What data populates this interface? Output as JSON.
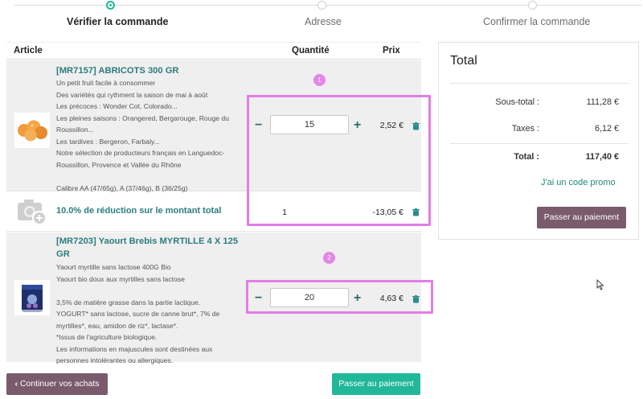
{
  "steps": [
    {
      "label": "Vérifier la commande",
      "active": true
    },
    {
      "label": "Adresse",
      "active": false
    },
    {
      "label": "Confirmer la commande",
      "active": false
    }
  ],
  "table": {
    "headers": {
      "article": "Article",
      "quantity": "Quantité",
      "price": "Prix"
    }
  },
  "items": [
    {
      "title_line1": "[MR7157] ABRICOTS 300 GR",
      "title_line2": "",
      "description": "Un petit fruit facile à consommer\nDes variétés qui rythment la saison de mai à août\nLes précoces : Wonder Cot, Colorado...\nLes pleines saisons : Orangered, Bergarouge, Rouge du\nRoussillon...\nLes tardives : Bergeron, Farbaly...\nNotre sélection de producteurs français en Languedoc-\nRoussillon, Provence et Vallée du Rhône\n\nCalibre AA (47/65g), A (37/46g), B (36/25g)",
      "quantity": "15",
      "price": "2,52 €",
      "image_icon": "apricots-photo",
      "badge": "1"
    },
    {
      "title_line1": "10.0% de réduction sur le montant total",
      "quantity": "1",
      "price": "-13,05 €",
      "image_icon": "camera-placeholder-icon"
    },
    {
      "title_line1": "[MR7203] Yaourt Brebis MYRTILLE 4 X 125",
      "title_line2": "GR",
      "description": "Yaourt myrtille sans lactose 400G Bio\nYaourt bio doux aux myrtilles sans lactose\n\n3,5% de matière grasse dans la partie lactique.\nYOGURT* sans lactose, sucre de canne brut*, 7% de\nmyrtilles*, eau, amidon de riz*, lactase*.\n*Issus de l'agriculture biologique.\nLes informations en majuscules sont destinées aux\npersonnes intolérantes ou allergiques.",
      "quantity": "20",
      "price": "4,63 €",
      "image_icon": "yogurt-photo",
      "badge": "2"
    }
  ],
  "buttons": {
    "continue": "Continuer vos achats",
    "pay_bottom": "Passer au paiement"
  },
  "summary": {
    "title": "Total",
    "subtotal_label": "Sous-total :",
    "subtotal_value": "111,28 €",
    "taxes_label": "Taxes :",
    "taxes_value": "6,12 €",
    "total_label": "Total :",
    "total_value": "117,40 €",
    "promo": "J'ai un code promo",
    "pay_button": "Passer au paiement"
  },
  "colors": {
    "accent_teal": "#21b799",
    "title_teal": "#2c7c7d",
    "button_plum": "#7a5b6e",
    "highlight_pink": "#e27ee6"
  }
}
